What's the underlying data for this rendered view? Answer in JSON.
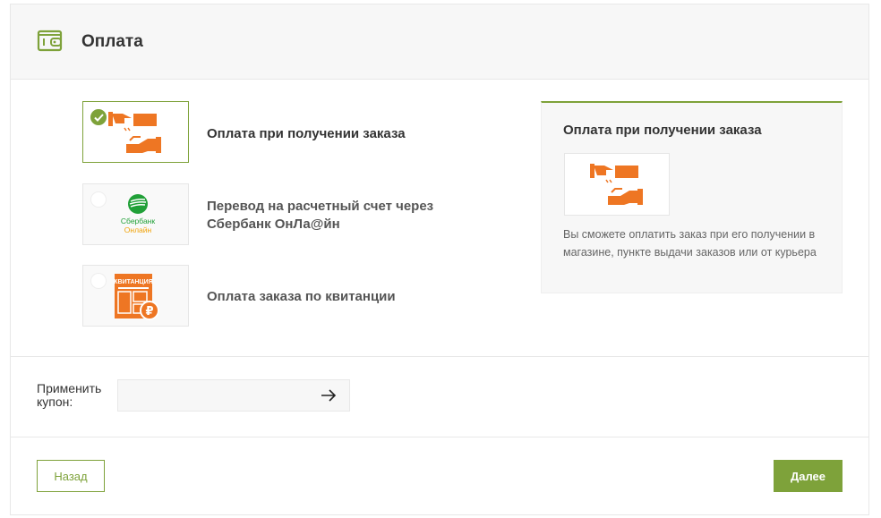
{
  "header": {
    "title": "Оплата",
    "icon": "wallet-icon"
  },
  "payment_options": [
    {
      "label": "Оплата при получении заказа",
      "selected": true,
      "icon": "cash-hands-icon"
    },
    {
      "label": "Перевод на расчетный счет через Сбербанк ОнЛа@йн",
      "selected": false,
      "icon": "sberbank-logo",
      "logo_text": [
        "Сбербанк",
        "Онлайн"
      ]
    },
    {
      "label": "Оплата заказа по квитанции",
      "selected": false,
      "icon": "receipt-icon",
      "logo_text": "КВИТАНЦИЯ"
    }
  ],
  "info_panel": {
    "title": "Оплата при получении заказа",
    "description": "Вы сможете оплатить заказ при его получении в магазине, пункте выдачи заказов или от курьера",
    "icon": "cash-hands-icon"
  },
  "coupon": {
    "label": "Применить купон:",
    "value": "",
    "submit_icon": "arrow-right-icon"
  },
  "actions": {
    "back_label": "Назад",
    "next_label": "Далее"
  },
  "colors": {
    "accent": "#7ea23a",
    "orange": "#ee7623",
    "sber_green": "#21a038"
  }
}
